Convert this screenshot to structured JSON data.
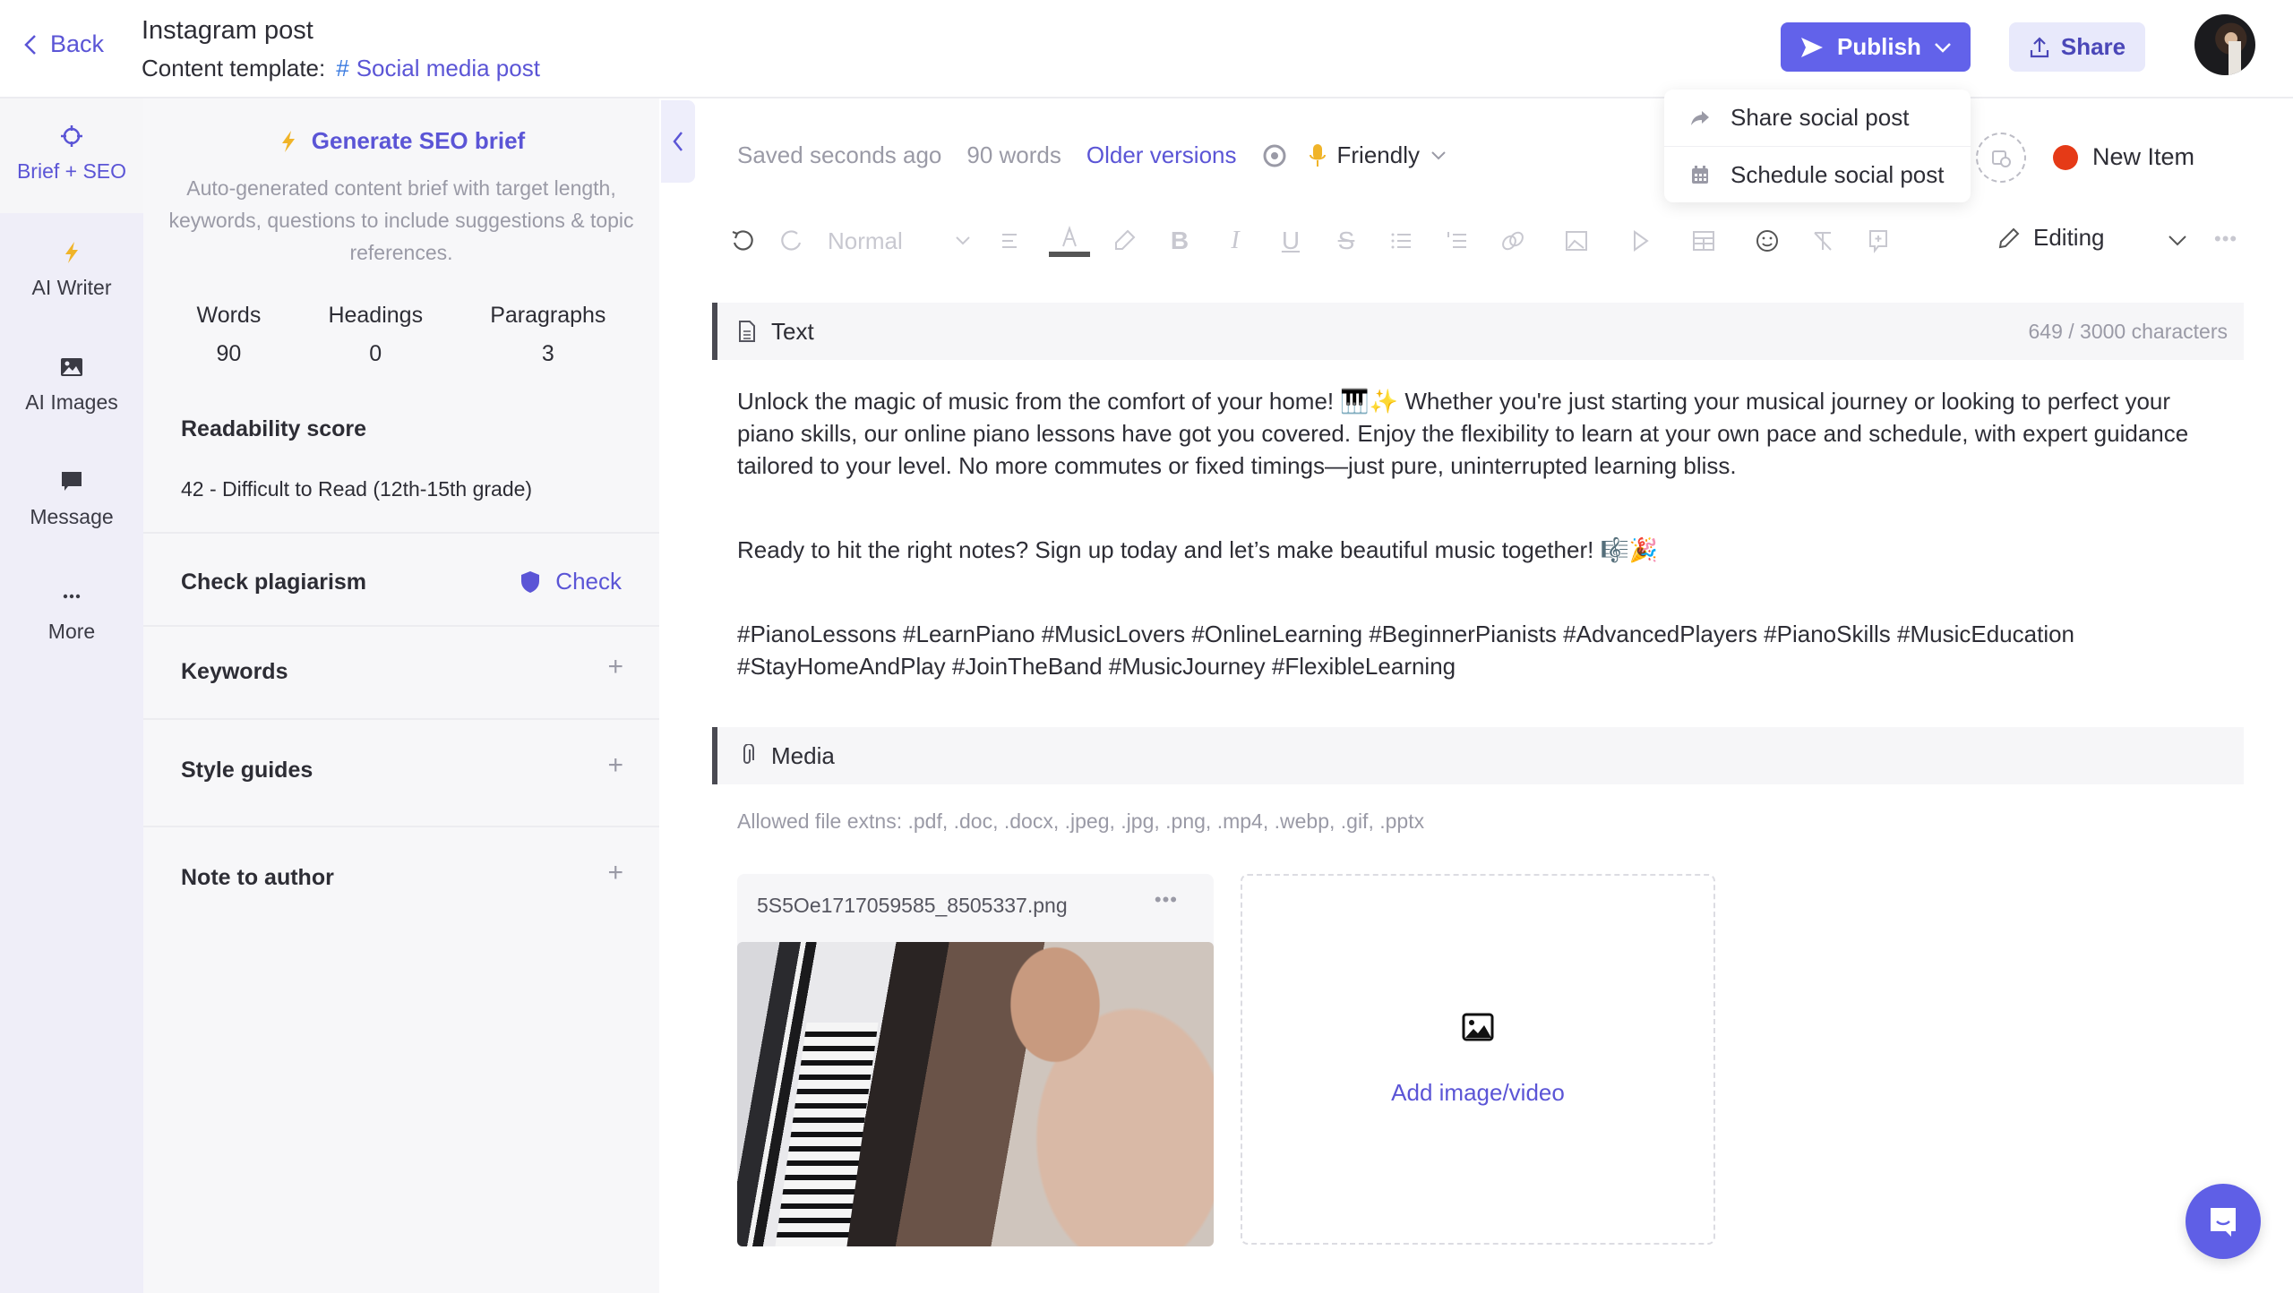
{
  "header": {
    "back_label": "Back",
    "title": "Instagram post",
    "template_label": "Content template:",
    "template_hash": "#",
    "template_name": "Social media post",
    "publish_label": "Publish",
    "share_label": "Share"
  },
  "publish_menu": {
    "items": [
      {
        "label": "Share social post",
        "icon": "share-arrow-icon"
      },
      {
        "label": "Schedule social post",
        "icon": "calendar-icon"
      }
    ]
  },
  "rail": {
    "items": [
      {
        "label": "Brief + SEO",
        "icon": "target-icon",
        "active": true
      },
      {
        "label": "AI Writer",
        "icon": "lightning-icon"
      },
      {
        "label": "AI Images",
        "icon": "image-icon"
      },
      {
        "label": "Message",
        "icon": "chat-bubble-icon"
      },
      {
        "label": "More",
        "icon": "more-dots-icon"
      }
    ]
  },
  "brief": {
    "generate_label": "Generate SEO brief",
    "description": "Auto-generated content brief with target length, keywords, questions to include suggestions & topic references.",
    "stats": [
      {
        "label": "Words",
        "value": "90"
      },
      {
        "label": "Headings",
        "value": "0"
      },
      {
        "label": "Paragraphs",
        "value": "3"
      }
    ],
    "readability_title": "Readability score",
    "readability_value": "42 - Difficult to Read (12th-15th grade)",
    "plagiarism_title": "Check plagiarism",
    "plagiarism_action": "Check",
    "keywords_title": "Keywords",
    "style_guides_title": "Style guides",
    "note_title": "Note to author"
  },
  "status": {
    "saved": "Saved seconds ago",
    "words": "90 words",
    "older_versions": "Older versions",
    "tone": "Friendly",
    "new_item": "New Item"
  },
  "toolbar": {
    "style_select": "Normal",
    "mode": "Editing"
  },
  "text_block": {
    "title": "Text",
    "char_count": "649 / 3000 characters",
    "paragraphs": [
      "Unlock the magic of music from the comfort of your home! 🎹✨ Whether you're just starting your musical journey or looking to perfect your piano skills, our online piano lessons have got you covered. Enjoy the flexibility to learn at your own pace and schedule, with expert guidance tailored to your level. No more commutes or fixed timings—just pure, uninterrupted learning bliss.",
      "Ready to hit the right notes? Sign up today and let’s make beautiful music together! 🎼🎉",
      "#PianoLessons #LearnPiano #MusicLovers #OnlineLearning #BeginnerPianists #AdvancedPlayers #PianoSkills #MusicEducation #StayHomeAndPlay #JoinTheBand #MusicJourney #FlexibleLearning"
    ]
  },
  "media_block": {
    "title": "Media",
    "allowed": "Allowed file extns: .pdf, .doc, .docx, .jpeg, .jpg, .png, .mp4, .webp, .gif, .pptx",
    "file_name": "5S5Oe1717059585_8505337.png",
    "file_menu": "•••",
    "add_label": "Add image/video"
  },
  "colors": {
    "accent": "#5b55d6",
    "publish": "#6262ea",
    "status_dot": "#e53a17"
  }
}
